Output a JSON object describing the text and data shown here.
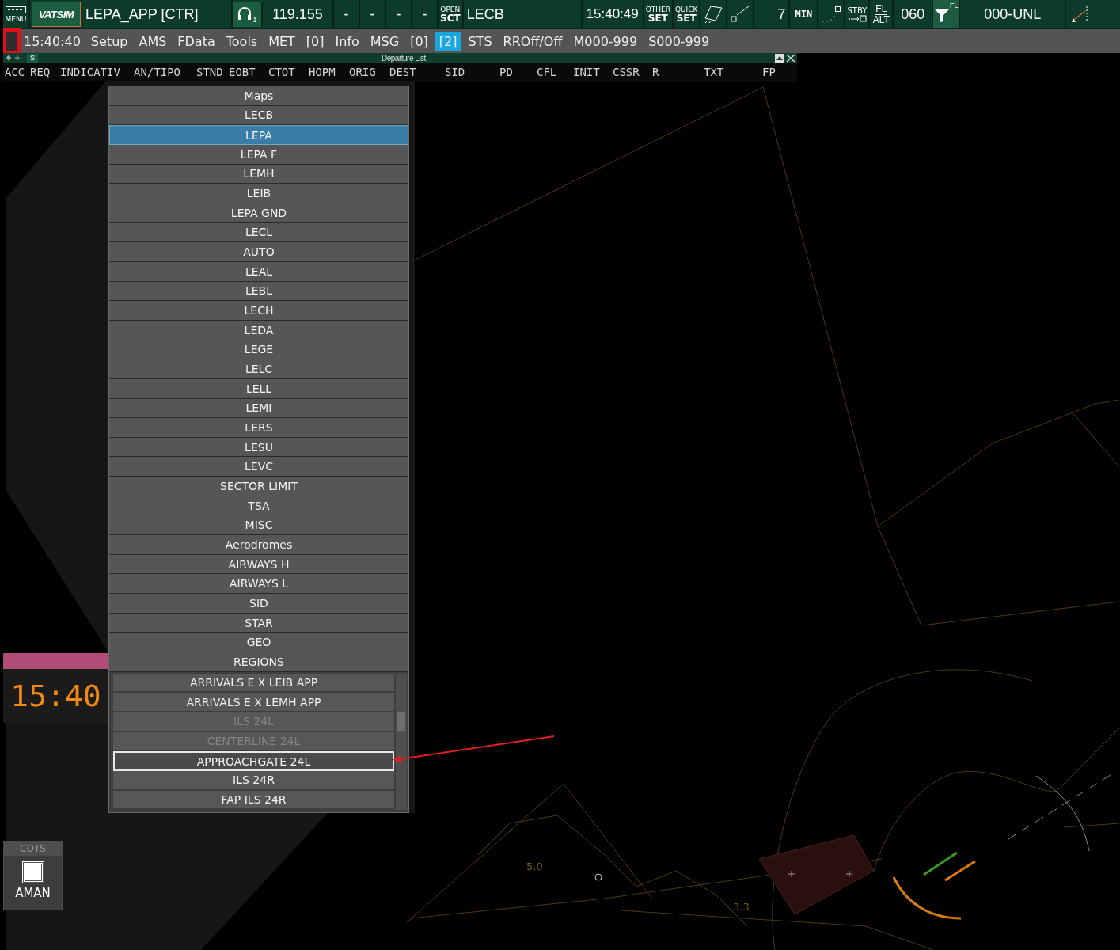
{
  "top_bar": {
    "menu_label": "MENU",
    "logo": "VATSIM",
    "callsign": "LEPA_APP [CTR]",
    "headset_count": "1",
    "frequency": "119.155",
    "slots": [
      "-",
      "-",
      "-",
      "-"
    ],
    "sector": {
      "top": "OPEN",
      "bottom": "SCT"
    },
    "sector_name": "LECB",
    "time": "15:40:49",
    "set_buttons": [
      {
        "top": "OTHER",
        "bottom": "SET"
      },
      {
        "top": "QUICK",
        "bottom": "SET"
      }
    ],
    "range": "7",
    "min_label": "MIN",
    "stby_label": "STBY",
    "fl_alt": {
      "top": "FL",
      "bottom": "ALT"
    },
    "transition": "060",
    "filter_label": "FL",
    "filter_range": "000-UNL"
  },
  "menu_bar": {
    "marker_highlighted": true,
    "clock": "15:40:40",
    "items": [
      {
        "label": "Setup",
        "selected": false
      },
      {
        "label": "AMS",
        "selected": false
      },
      {
        "label": "FData",
        "selected": false
      },
      {
        "label": "Tools",
        "selected": false
      },
      {
        "label": "MET",
        "selected": false
      },
      {
        "label": "[0]",
        "selected": false
      },
      {
        "label": "Info",
        "selected": false
      },
      {
        "label": "MSG",
        "selected": false
      },
      {
        "label": "[0]",
        "selected": false
      },
      {
        "label": "[2]",
        "selected": true
      },
      {
        "label": "STS",
        "selected": false
      },
      {
        "label": "RROff/Off",
        "selected": false
      },
      {
        "label": "M000-999",
        "selected": false
      },
      {
        "label": "S000-999",
        "selected": false
      }
    ]
  },
  "departure_list": {
    "title": "Departure List",
    "sort_label": "S",
    "columns": [
      "ACC",
      "REQ",
      "INDICATIV",
      "AN/TIPO",
      "STND",
      "EOBT",
      "CTOT",
      "HOPM",
      "ORIG",
      "DEST",
      "SID",
      "PD",
      "CFL",
      "INIT",
      "CSSR",
      "R",
      "TXT",
      "FP"
    ]
  },
  "maps_menu": {
    "title": "Maps",
    "items": [
      {
        "label": "LECB",
        "selected": false
      },
      {
        "label": "LEPA",
        "selected": true
      },
      {
        "label": "LEPA F",
        "selected": false
      },
      {
        "label": "LEMH",
        "selected": false
      },
      {
        "label": "LEIB",
        "selected": false
      },
      {
        "label": "LEPA GND",
        "selected": false
      },
      {
        "label": "LECL",
        "selected": false
      },
      {
        "label": "AUTO",
        "selected": false
      },
      {
        "label": "LEAL",
        "selected": false
      },
      {
        "label": "LEBL",
        "selected": false
      },
      {
        "label": "LECH",
        "selected": false
      },
      {
        "label": "LEDA",
        "selected": false
      },
      {
        "label": "LEGE",
        "selected": false
      },
      {
        "label": "LELC",
        "selected": false
      },
      {
        "label": "LELL",
        "selected": false
      },
      {
        "label": "LEMI",
        "selected": false
      },
      {
        "label": "LERS",
        "selected": false
      },
      {
        "label": "LESU",
        "selected": false
      },
      {
        "label": "LEVC",
        "selected": false
      },
      {
        "label": "SECTOR LIMIT",
        "selected": false
      },
      {
        "label": "TSA",
        "selected": false
      },
      {
        "label": "MISC",
        "selected": false
      },
      {
        "label": "Aerodromes",
        "selected": false
      },
      {
        "label": "AIRWAYS H",
        "selected": false
      },
      {
        "label": "AIRWAYS L",
        "selected": false
      },
      {
        "label": "SID",
        "selected": false
      },
      {
        "label": "STAR",
        "selected": false
      },
      {
        "label": "GEO",
        "selected": false
      },
      {
        "label": "REGIONS",
        "selected": false
      }
    ],
    "sub_items": [
      {
        "label": "ARRIVALS E X LEIB APP",
        "disabled": false,
        "outlined": false
      },
      {
        "label": "ARRIVALS E X LEMH APP",
        "disabled": false,
        "outlined": false
      },
      {
        "label": "ILS 24L",
        "disabled": true,
        "outlined": false
      },
      {
        "label": "CENTERLINE 24L",
        "disabled": true,
        "outlined": false
      },
      {
        "label": "APPROACHGATE 24L",
        "disabled": false,
        "outlined": true
      },
      {
        "label": "ILS 24R",
        "disabled": false,
        "outlined": false
      },
      {
        "label": "FAP ILS 24R",
        "disabled": false,
        "outlined": false
      }
    ]
  },
  "clock": "15:40",
  "cots": {
    "title": "COTS",
    "label": "AMAN",
    "checked": false
  },
  "map_labels": [
    "5.0",
    "3.3"
  ]
}
